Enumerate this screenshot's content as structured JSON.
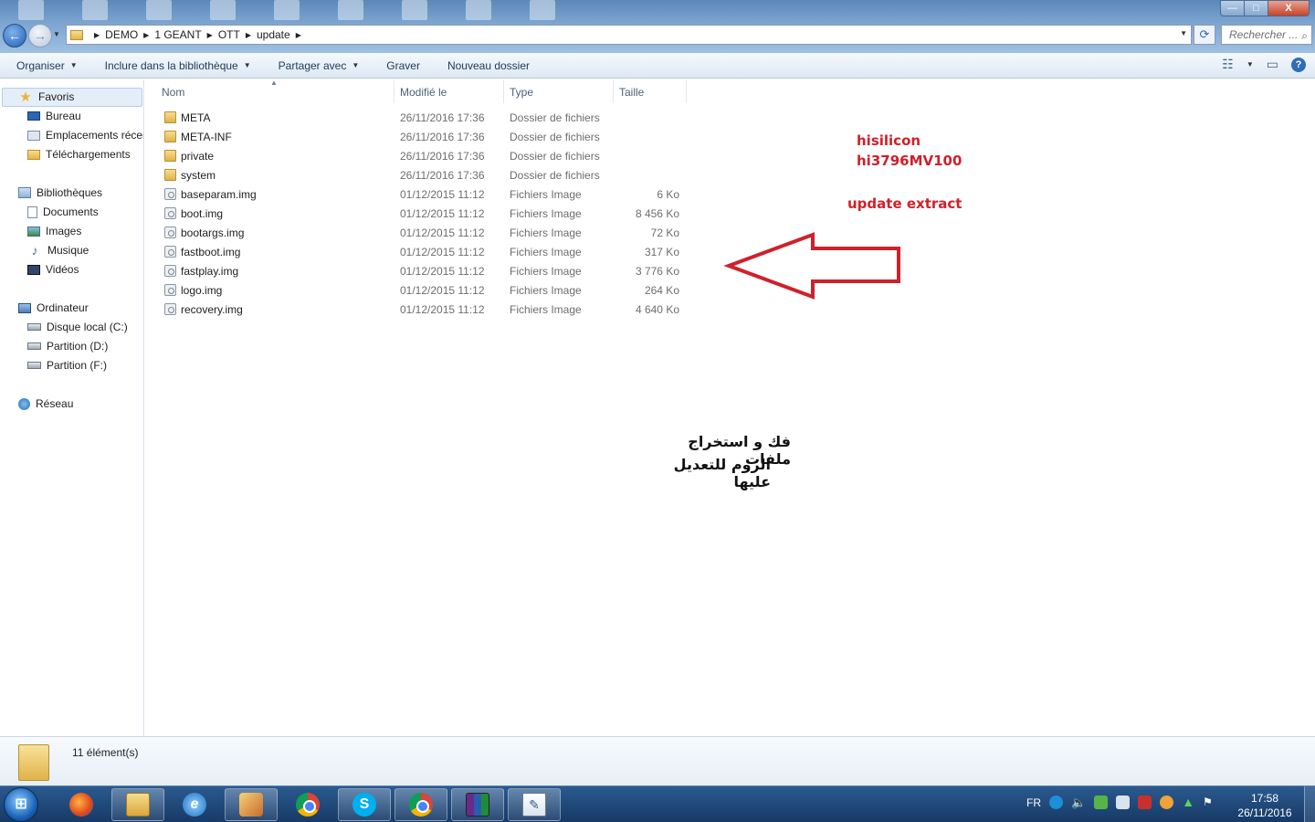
{
  "breadcrumb": [
    "DEMO",
    "1 GEANT",
    "OTT",
    "update"
  ],
  "search_placeholder": "Rechercher ...",
  "toolbar": {
    "organize": "Organiser",
    "include_library": "Inclure dans la bibliothèque",
    "share": "Partager avec",
    "burn": "Graver",
    "new_folder": "Nouveau dossier",
    "help": "?"
  },
  "window_controls": {
    "minimize": "—",
    "maximize": "□",
    "close": "X"
  },
  "nav": {
    "favorites": "Favoris",
    "desktop": "Bureau",
    "recent": "Emplacements récents",
    "downloads": "Téléchargements",
    "libraries": "Bibliothèques",
    "documents": "Documents",
    "pictures": "Images",
    "music": "Musique",
    "videos": "Vidéos",
    "computer": "Ordinateur",
    "drive_c": "Disque local (C:)",
    "drive_d": "Partition (D:)",
    "drive_f": "Partition (F:)",
    "network": "Réseau"
  },
  "columns": {
    "name": "Nom",
    "modified": "Modifié le",
    "type": "Type",
    "size": "Taille"
  },
  "files": [
    {
      "name": "META",
      "date": "26/11/2016 17:36",
      "type": "Dossier de fichiers",
      "size": ""
    },
    {
      "name": "META-INF",
      "date": "26/11/2016 17:36",
      "type": "Dossier de fichiers",
      "size": ""
    },
    {
      "name": "private",
      "date": "26/11/2016 17:36",
      "type": "Dossier de fichiers",
      "size": ""
    },
    {
      "name": "system",
      "date": "26/11/2016 17:36",
      "type": "Dossier de fichiers",
      "size": ""
    },
    {
      "name": "baseparam.img",
      "date": "01/12/2015 11:12",
      "type": "Fichiers Image",
      "size": "6 Ko"
    },
    {
      "name": "boot.img",
      "date": "01/12/2015 11:12",
      "type": "Fichiers Image",
      "size": "8 456 Ko"
    },
    {
      "name": "bootargs.img",
      "date": "01/12/2015 11:12",
      "type": "Fichiers Image",
      "size": "72 Ko"
    },
    {
      "name": "fastboot.img",
      "date": "01/12/2015 11:12",
      "type": "Fichiers Image",
      "size": "317 Ko"
    },
    {
      "name": "fastplay.img",
      "date": "01/12/2015 11:12",
      "type": "Fichiers Image",
      "size": "3 776 Ko"
    },
    {
      "name": "logo.img",
      "date": "01/12/2015 11:12",
      "type": "Fichiers Image",
      "size": "264 Ko"
    },
    {
      "name": "recovery.img",
      "date": "01/12/2015 11:12",
      "type": "Fichiers Image",
      "size": "4 640 Ko"
    }
  ],
  "annotations": {
    "line1": "hisilicon",
    "line2": "hi3796MV100",
    "line3": "update extract",
    "arabic1": "فك و استخراج ملفات",
    "arabic2": "الروم للتعديل عليها",
    "arrow_color": "#d0202a"
  },
  "status": {
    "count": "11 élément(s)"
  },
  "taskbar": {
    "lang": "FR",
    "time": "17:58",
    "date": "26/11/2016",
    "start": "⊞",
    "apps": [
      "firefox-icon",
      "explorer-icon",
      "ie-icon",
      "paint-icon",
      "chrome-icon",
      "skype-icon",
      "chrome-icon",
      "winrar-icon",
      "notepad-icon"
    ]
  }
}
